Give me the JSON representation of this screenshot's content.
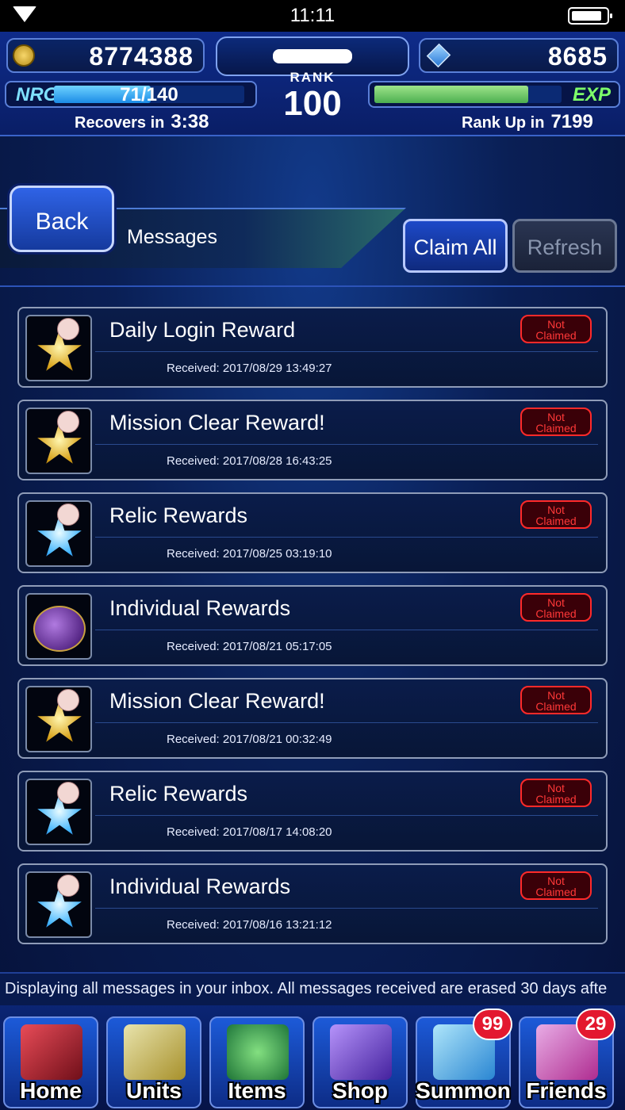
{
  "status_bar": {
    "time": "11:11"
  },
  "header": {
    "gil": "8774388",
    "lapis": "8685",
    "rank_label": "RANK",
    "rank": "100",
    "nrg_label": "NRG",
    "nrg_current": "71",
    "nrg_max": "140",
    "nrg_text": "71/140",
    "nrg_fraction": 0.507,
    "recovers_label": "Recovers in",
    "recovers_time": "3:38",
    "exp_label": "EXP",
    "exp_fraction": 0.82,
    "rankup_label": "Rank Up in",
    "rankup_value": "7199"
  },
  "toolbar": {
    "back_label": "Back",
    "title": "Messages",
    "claim_all_label": "Claim All",
    "refresh_label": "Refresh"
  },
  "messages": [
    {
      "title": "Daily Login Reward",
      "received": "Received: 2017/08/29 13:49:27",
      "status": "Not Claimed",
      "icon": "gold-star-moogle-icon"
    },
    {
      "title": "Mission Clear Reward!",
      "received": "Received: 2017/08/28 16:43:25",
      "status": "Not Claimed",
      "icon": "gold-star-moogle-icon"
    },
    {
      "title": "Relic Rewards",
      "received": "Received: 2017/08/25 03:19:10",
      "status": "Not Claimed",
      "icon": "blue-star-moogle-icon"
    },
    {
      "title": "Individual Rewards",
      "received": "Received: 2017/08/21 05:17:05",
      "status": "Not Claimed",
      "icon": "magic-pot-icon"
    },
    {
      "title": "Mission Clear Reward!",
      "received": "Received: 2017/08/21 00:32:49",
      "status": "Not Claimed",
      "icon": "gold-star-moogle-icon"
    },
    {
      "title": "Relic Rewards",
      "received": "Received: 2017/08/17 14:08:20",
      "status": "Not Claimed",
      "icon": "blue-star-moogle-icon"
    },
    {
      "title": "Individual Rewards",
      "received": "Received: 2017/08/16 13:21:12",
      "status": "Not Claimed",
      "icon": "blue-star-moogle-icon"
    }
  ],
  "footer_note": "Displaying all messages in your inbox. All messages received are erased 30 days afte",
  "nav": [
    {
      "label": "Home",
      "icon": "sword-icon"
    },
    {
      "label": "Units",
      "icon": "hero-icon"
    },
    {
      "label": "Items",
      "icon": "potion-icon"
    },
    {
      "label": "Shop",
      "icon": "chest-icon"
    },
    {
      "label": "Summon",
      "icon": "crystal-icon",
      "badge": "99"
    },
    {
      "label": "Friends",
      "icon": "friends-icon",
      "badge": "29"
    }
  ]
}
